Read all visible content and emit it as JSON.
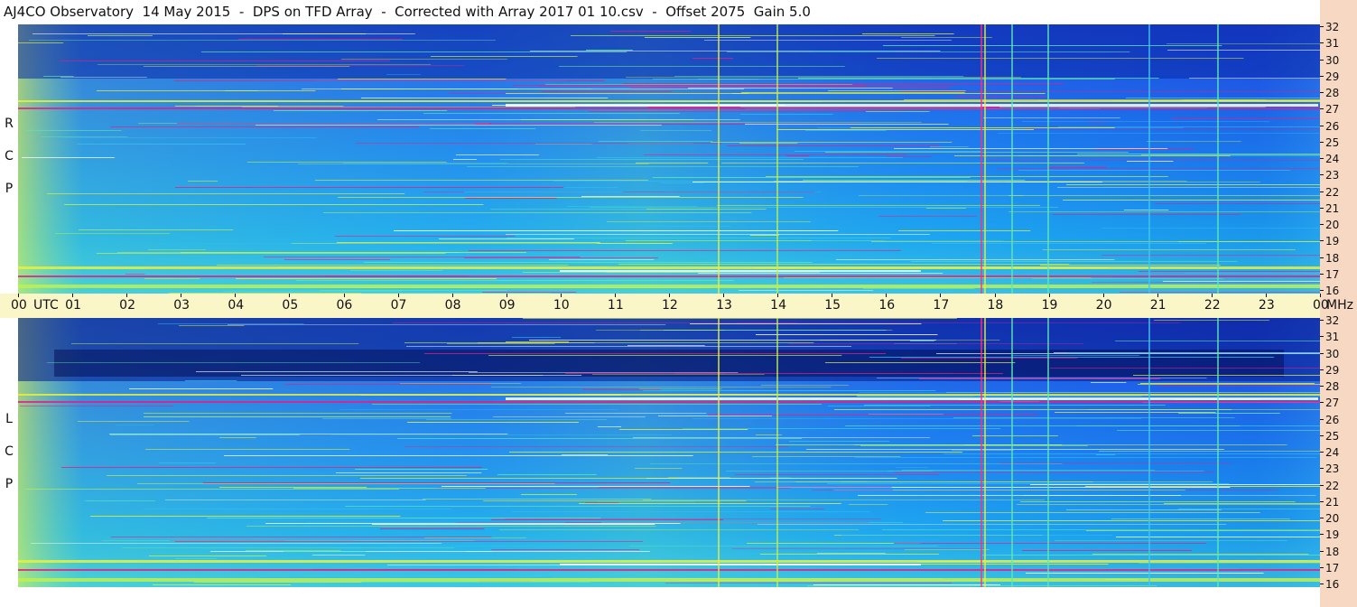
{
  "title": "AJ4CO Observatory  14 May 2015  -  DPS on TFD Array  -  Corrected with Array 2017 01 10.csv  -  Offset 2075  Gain 5.0",
  "chart_data": [
    {
      "type": "heatmap",
      "panel": "RCP",
      "polarization_label": [
        "R",
        "C",
        "P"
      ],
      "x_axis": {
        "unit": "UTC",
        "range": [
          "00",
          "00"
        ],
        "ticks": [
          "00",
          "01",
          "02",
          "03",
          "04",
          "05",
          "06",
          "07",
          "08",
          "09",
          "10",
          "11",
          "12",
          "13",
          "14",
          "15",
          "16",
          "17",
          "18",
          "19",
          "20",
          "21",
          "22",
          "23",
          "00"
        ]
      },
      "y_axis": {
        "unit": "MHz",
        "range": [
          16,
          32
        ],
        "ticks": [
          16,
          17,
          18,
          19,
          20,
          21,
          22,
          23,
          24,
          25,
          26,
          27,
          28,
          29,
          30,
          31,
          32
        ]
      },
      "colors": {
        "low": "#000a5a",
        "mid": "#1aa6f0",
        "high": "#e8f040",
        "peak": "#ffffff",
        "hot": "#e0208a"
      }
    },
    {
      "type": "heatmap",
      "panel": "LCP",
      "polarization_label": [
        "L",
        "C",
        "P"
      ],
      "x_axis": {
        "unit": "UTC",
        "range": [
          "00",
          "00"
        ],
        "ticks": [
          "00",
          "01",
          "02",
          "03",
          "04",
          "05",
          "06",
          "07",
          "08",
          "09",
          "10",
          "11",
          "12",
          "13",
          "14",
          "15",
          "16",
          "17",
          "18",
          "19",
          "20",
          "21",
          "22",
          "23",
          "00"
        ]
      },
      "y_axis": {
        "unit": "MHz",
        "range": [
          16,
          32
        ],
        "ticks": [
          16,
          17,
          18,
          19,
          20,
          21,
          22,
          23,
          24,
          25,
          26,
          27,
          28,
          29,
          30,
          31,
          32
        ]
      },
      "colors": {
        "low": "#000a5a",
        "mid": "#1aa6f0",
        "high": "#e8f040",
        "peak": "#ffffff",
        "hot": "#e0208a"
      }
    }
  ],
  "time_axis": {
    "labels": [
      "00",
      "01",
      "02",
      "03",
      "04",
      "05",
      "06",
      "07",
      "08",
      "09",
      "10",
      "11",
      "12",
      "13",
      "14",
      "15",
      "16",
      "17",
      "18",
      "19",
      "20",
      "21",
      "22",
      "23",
      "00"
    ],
    "utc_label": "UTC",
    "mhz_label": "MHz"
  },
  "freq_labels": [
    "32",
    "31",
    "30",
    "29",
    "28",
    "27",
    "26",
    "25",
    "24",
    "23",
    "22",
    "21",
    "20",
    "19",
    "18",
    "17",
    "16"
  ],
  "pol_top": [
    "R",
    "C",
    "P"
  ],
  "pol_bot": [
    "L",
    "C",
    "P"
  ]
}
